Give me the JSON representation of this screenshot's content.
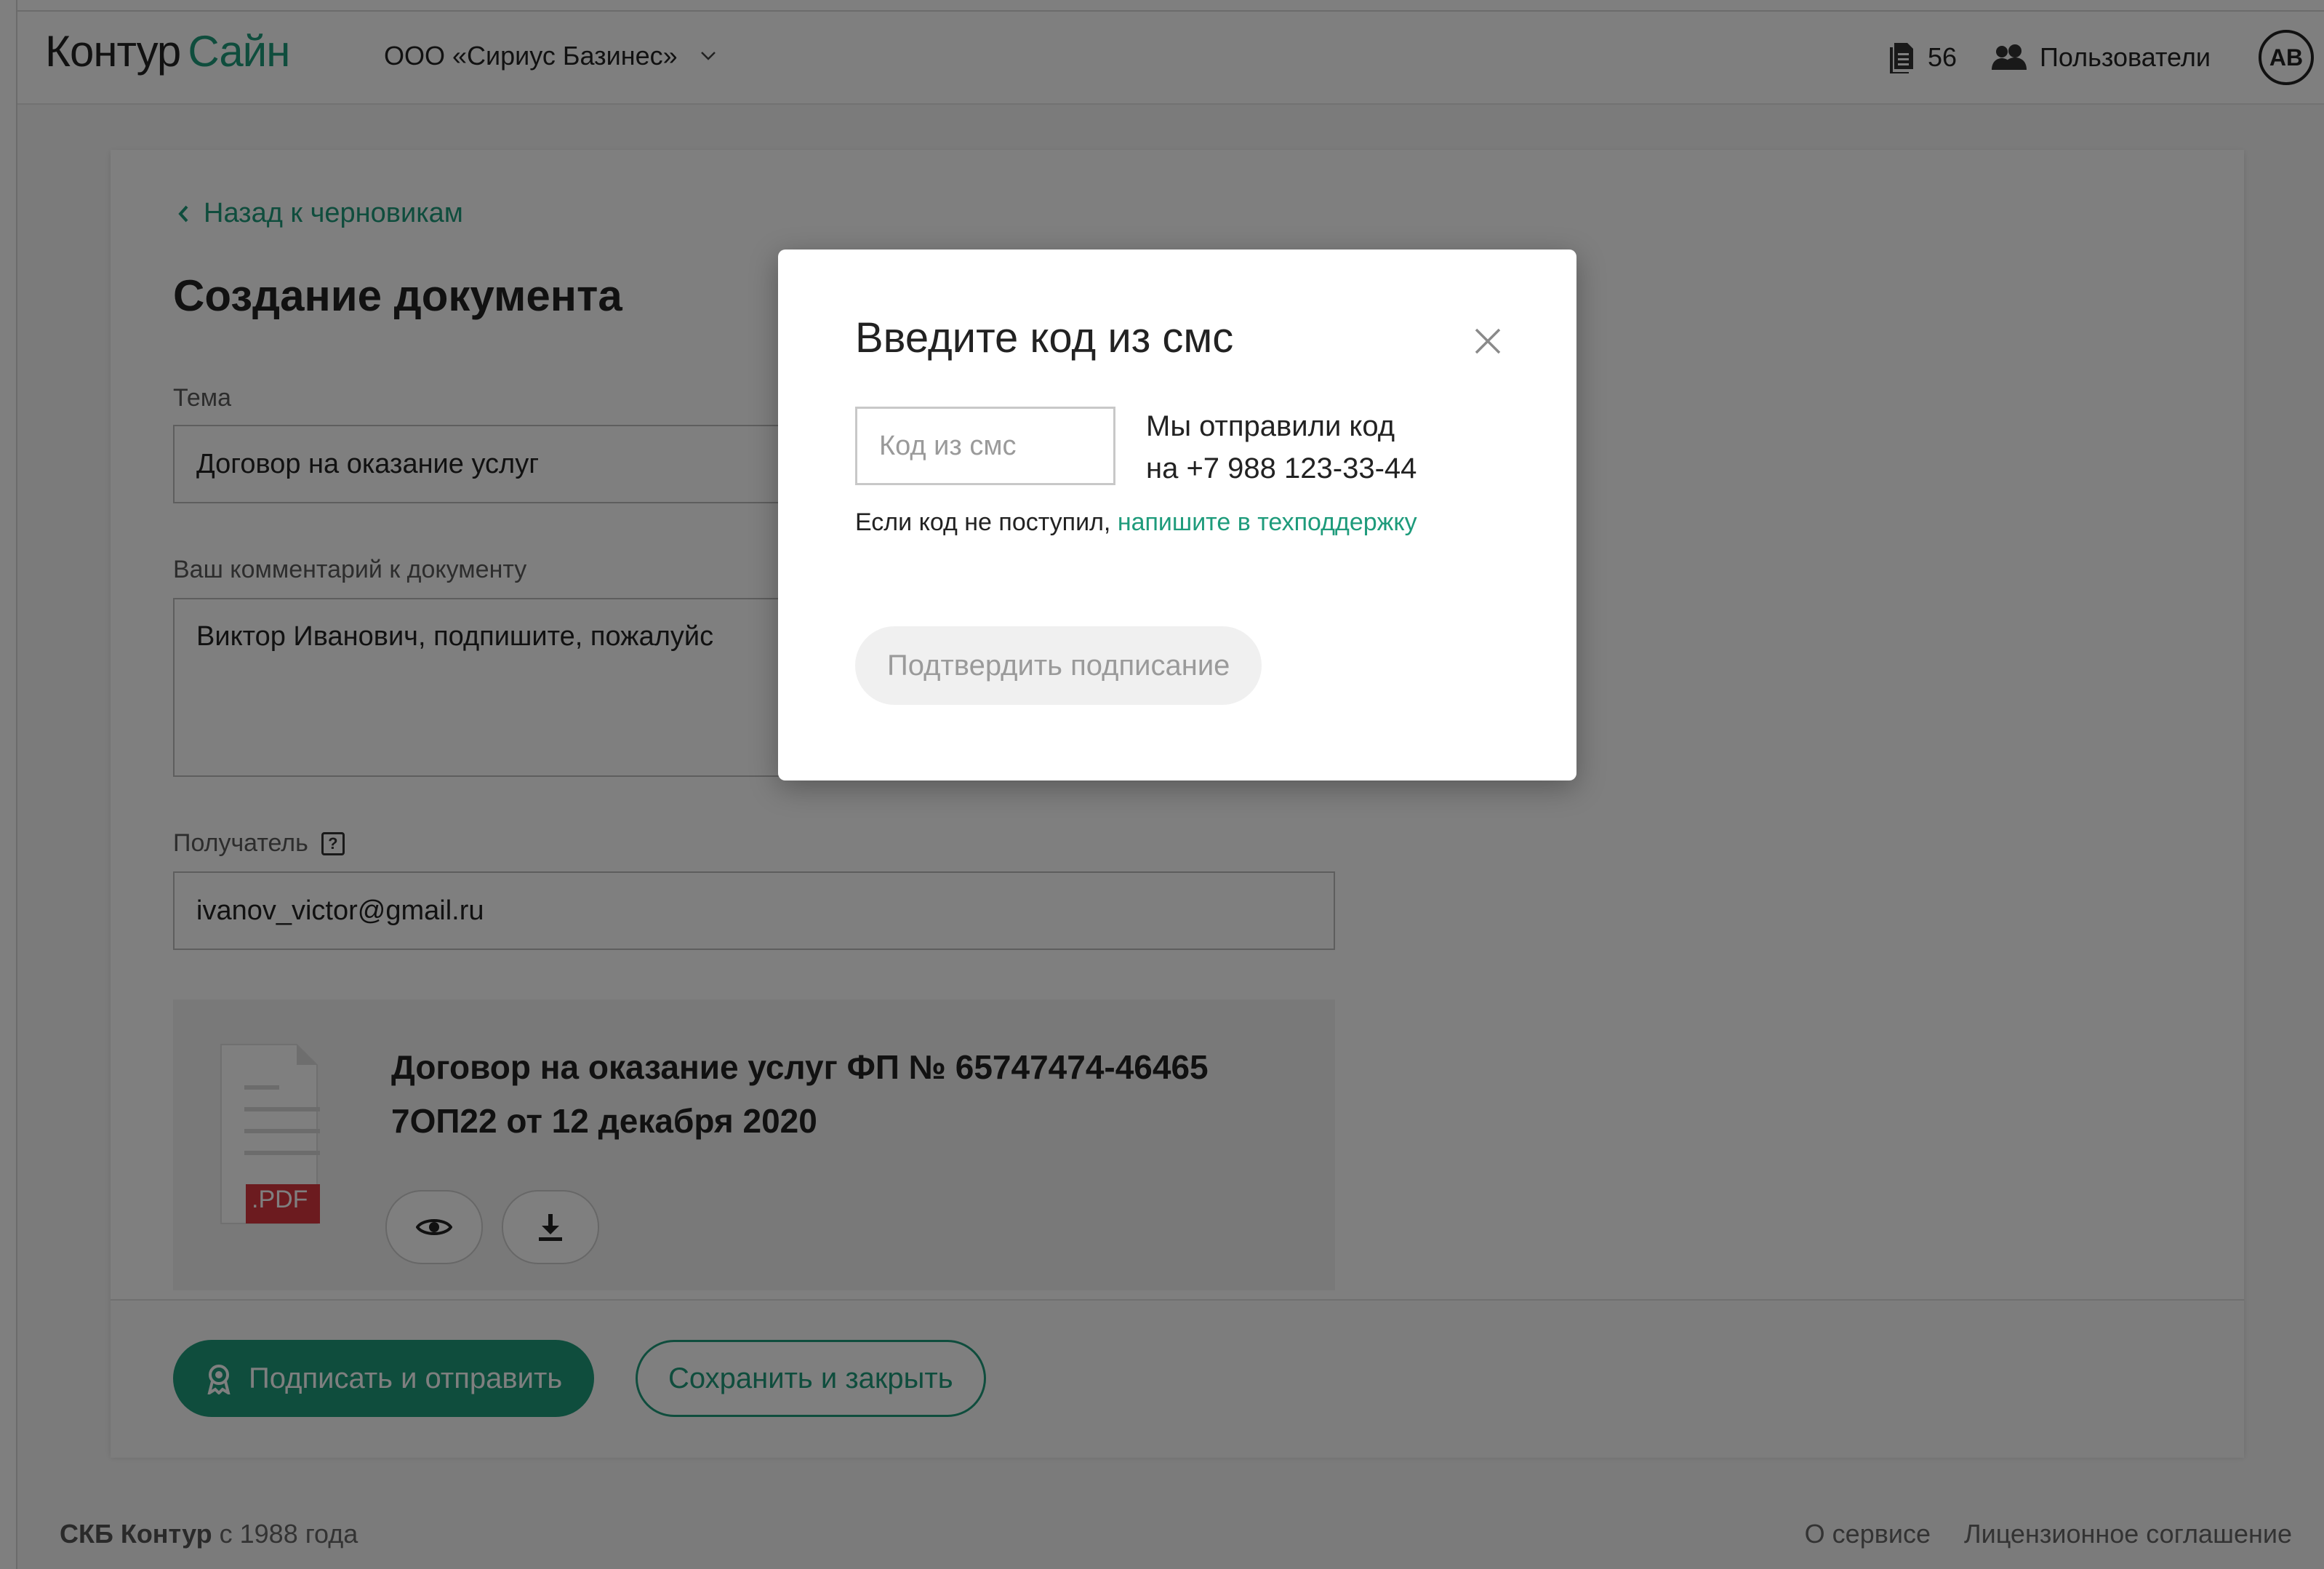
{
  "header": {
    "logo_part1": "Контур",
    "logo_part2": "Сайн",
    "org_name": "ООО «Сириус Базинес»",
    "docs_count": "56",
    "users_label": "Пользователи",
    "avatar_initials": "AB"
  },
  "form": {
    "back_link": "Назад к черновикам",
    "title": "Создание документа",
    "subject_label": "Тема",
    "subject_value": "Договор на оказание услуг",
    "comment_label": "Ваш комментарий к документу",
    "comment_value": "Виктор Иванович, подпишите, пожалуйс",
    "recipient_label": "Получатель",
    "recipient_help": "?",
    "recipient_value": "ivanov_victor@gmail.ru"
  },
  "document": {
    "title_line1": "Договор на оказание услуг ФП № 65747474-46465",
    "title_line2": "7ОП22 от 12 декабря 2020",
    "file_badge": ".PDF"
  },
  "actions": {
    "sign_send": "Подписать и отправить",
    "save_close": "Сохранить и закрыть"
  },
  "footer": {
    "company": "СКБ Контур",
    "since": " с 1988 года",
    "about": "О сервисе",
    "license": "Лицензионное соглашение"
  },
  "modal": {
    "title": "Введите код из смс",
    "input_placeholder": "Код из смс",
    "sent_line1": "Мы отправили код",
    "sent_line2": "на +7 988 123-33-44",
    "help_text": "Если код не поступил, ",
    "help_link": "напишите в техподдержку",
    "confirm_button": "Подтвердить подписание"
  },
  "colors": {
    "accent": "#1e9b7b",
    "pdf_badge": "#d9363e",
    "overlay": "rgba(0,0,0,0.5)"
  },
  "icons": {
    "docs": "document-stack-icon",
    "users": "users-icon",
    "org_dropdown": "chevron-down-icon",
    "back": "chevron-left-icon",
    "help": "question-icon",
    "file": "pdf-file-icon",
    "preview": "eye-icon",
    "download": "download-icon",
    "sign": "award-icon",
    "close": "close-icon"
  }
}
